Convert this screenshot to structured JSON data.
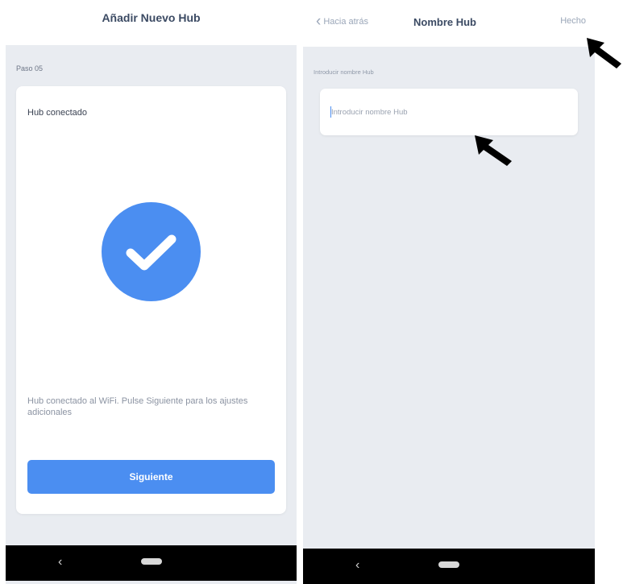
{
  "screen_left": {
    "title": "Añadir Nuevo Hub",
    "step": "Paso 05",
    "card_title": "Hub conectado",
    "description": "Hub conectado al WiFi. Pulse Siguiente para los ajustes adicionales",
    "next_button": "Siguiente",
    "status_icon": "checkmark-icon",
    "accent_color": "#4b8ef1"
  },
  "screen_right": {
    "back_label": "Hacia atrás",
    "title": "Nombre Hub",
    "done_label": "Hecho",
    "field_label": "Introducir nombre Hub",
    "input_value": "",
    "input_placeholder": "Introducir nombre Hub"
  },
  "nav": {
    "back_icon": "‹",
    "home_icon": "home-pill-icon"
  },
  "annotations": {
    "arrow_icon": "pointer-arrow-icon",
    "color": "#000000"
  }
}
